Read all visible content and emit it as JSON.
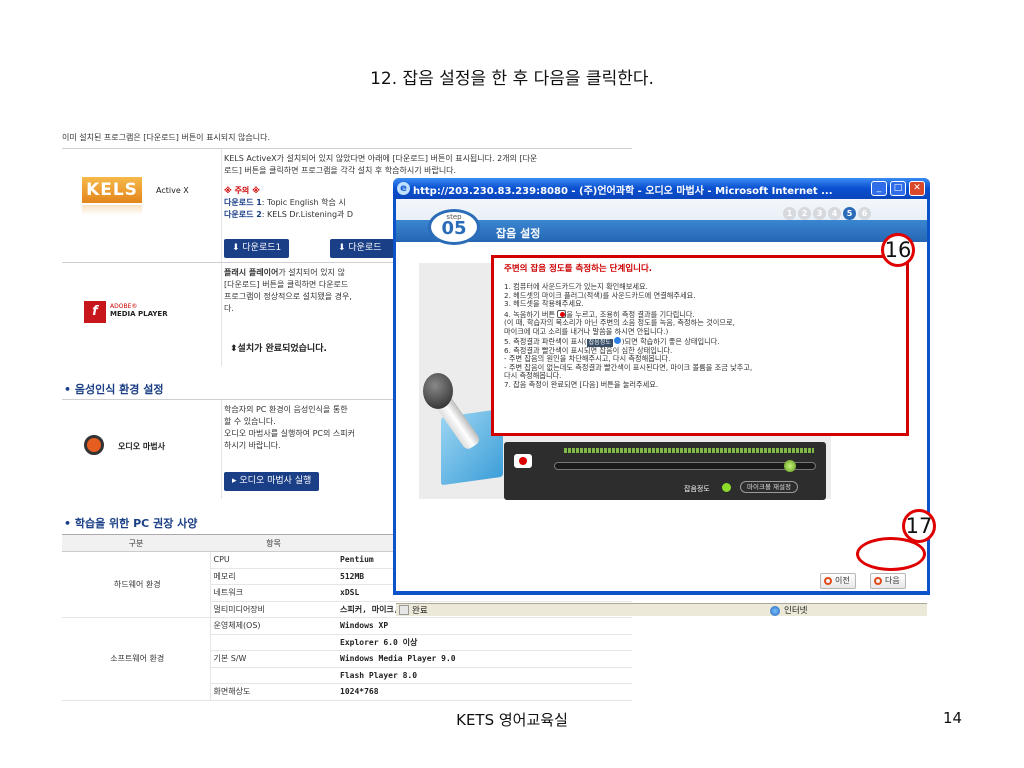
{
  "slide": {
    "title": "12. 잡음 설정을 한 후 다음을 클릭한다.",
    "footer": "KETS 영어교육실",
    "page_number": "14"
  },
  "page": {
    "intro": "이미 설치된 프로그램은 [다운로드] 버튼이 표시되지 않습니다.",
    "kels": {
      "logo": "KELS",
      "logo_suffix": "Active X",
      "desc_line1": "KELS ActiveX가 설치되어 있지 않았다면 아래에 [다운로드] 버튼이 표시됩니다. 2개의 [다운",
      "desc_line2": "로드] 버튼을 클릭하면 프로그램을 각각 설치 후 학습하시기 바랍니다.",
      "note": "※ 주의 ※",
      "dl1_label": "다운로드 1",
      "dl1_text": ": Topic English 학습 시",
      "dl2_label": "다운로드 2",
      "dl2_text": ": KELS Dr.Listening과 D",
      "btn1": "다운로드1",
      "btn2": "다운로드"
    },
    "flash": {
      "logo_line1": "ADOBE®",
      "logo_line2": "MEDIA PLAYER",
      "desc_bold": "플래시 플레이어",
      "desc_line1": "가 설치되어 있지 않",
      "desc_line2": "[다운로드] 버튼을 클릭하면 다운로드",
      "desc_line3": "프로그램이 정상적으로 설치됐을 경우,",
      "desc_line4": "다.",
      "installed": "설치가 완료되었습니다."
    },
    "voice": {
      "heading": "• 음성인식 환경 설정",
      "logo": "오디오 마법사",
      "desc_line1": "학습자의 PC 환경이 음성인식을 통한 ",
      "desc_line2": "할 수 있습니다.",
      "desc_line3": "오디오 마법사를 실행하여 PC의 스피커",
      "desc_line4": "하시기 바랍니다.",
      "button": "▸ 오디오 마법사 실행"
    },
    "pc": {
      "heading": "• 학습을 위한 PC 권장 사양",
      "col_headers": [
        "구분",
        "항목"
      ],
      "rows": [
        {
          "group": "하드웨어 환경",
          "item": "CPU",
          "value": "Pentium"
        },
        {
          "group": "",
          "item": "메모리",
          "value": "512MB"
        },
        {
          "group": "",
          "item": "네트워크",
          "value": "xDSL"
        },
        {
          "group": "",
          "item": "멀티미디어장비",
          "value": "스피커, 마이크, 헤드셋"
        },
        {
          "group": "소프트웨어 환경",
          "item": "운영체제(OS)",
          "value": "Windows XP"
        },
        {
          "group": "",
          "item": "",
          "value": "Explorer 6.0 이상"
        },
        {
          "group": "",
          "item": "기본 S/W",
          "value": "Windows Media Player 9.0"
        },
        {
          "group": "",
          "item": "",
          "value": "Flash Player 8.0"
        },
        {
          "group": "",
          "item": "화면해상도",
          "value": "1024*768"
        }
      ]
    }
  },
  "window": {
    "title": "http://203.230.83.239:8080 - (주)언어과학 - 오디오 마법사 - Microsoft Internet ...",
    "step_label": "step",
    "step_number": "05",
    "step_title": "잡음 설정",
    "progress_dots": [
      "1",
      "2",
      "3",
      "4",
      "5",
      "6"
    ],
    "active_step": 5,
    "instructions": {
      "heading": "주변의 잡음 정도를 측정하는 단계입니다.",
      "lines": [
        "1.  컴퓨터에 사운드카드가 있는지 확인해보세요.",
        "2.  헤드셋의 마이크 플러그(적색)를 사운드카드에 연결해주세요.",
        "3.  헤드셋을 착용해주세요.",
        "4.  녹음하기 버튼",
        "을 누르고, 조용히 측정 결과를 기다립니다.",
        "     (이 때, 학습자의 목소리가 아닌 주변의 소음 정도를 녹음, 측정하는 것이므로,",
        "     마이크에 대고 소리를 내거나 말씀을 하시면 안됩니다.)",
        "5.  측정결과 파란색이 표시(",
        "잡음정도",
        ")되면 학습하기 좋은 상태입니다.",
        "6.  측정결과 빨간색이 표시되면 잡음이 심한 상태입니다.",
        "     -  주변 잡음의 원인을 차단해주시고, 다시 측정해봅니다.",
        "     -  주변 잡음이 없는데도 측정결과 빨간색이 표시된다면, 마이크 볼륨을 조금 낮추고,",
        "        다시 측정해봅니다.",
        "7.  잡음 측정이 완료되면 [다음] 버튼을 눌러주세요."
      ]
    },
    "meter": {
      "noise_label": "잡음정도",
      "mic_settings": "마이크볼 재설정",
      "slider_level": 0.9
    },
    "prev_button": "이전",
    "next_button": "다음",
    "status_done": "완료",
    "status_zone": "인터넷",
    "callouts": [
      "16",
      "17"
    ]
  }
}
